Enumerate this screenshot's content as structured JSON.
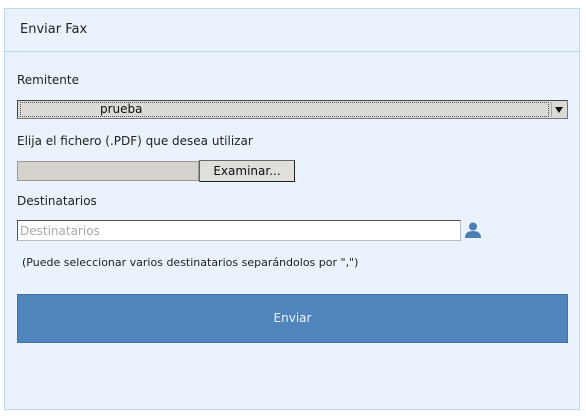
{
  "panel": {
    "title": "Enviar Fax"
  },
  "form": {
    "sender_label": "Remitente",
    "sender_value": "prueba",
    "file_label": "Elija el fichero (.PDF) que desea utilizar",
    "browse_label": "Examinar...",
    "recipients_label": "Destinatarios",
    "recipients_placeholder": "Destinatarios",
    "recipients_value": "",
    "hint": "(Puede seleccionar varios destinatarios separándolos por \",\")",
    "submit_label": "Enviar"
  },
  "icons": {
    "select_arrow": "chevron-down-icon",
    "recipients_picker": "user-icon"
  },
  "colors": {
    "panel_background": "#eaf3fb",
    "panel_border": "#b9d9ea",
    "submit_button": "#4f84bc"
  }
}
